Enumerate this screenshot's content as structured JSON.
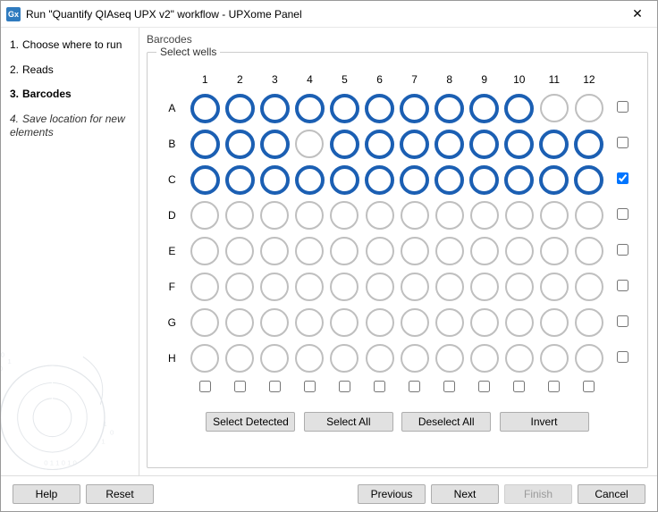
{
  "titlebar": {
    "icon_text": "Gx",
    "title": "Run \"Quantify QIAseq UPX v2\" workflow - UPXome Panel",
    "close_glyph": "✕"
  },
  "sidebar": {
    "steps": [
      {
        "num": "1.",
        "label": "Choose where to run",
        "state": "normal"
      },
      {
        "num": "2.",
        "label": "Reads",
        "state": "normal"
      },
      {
        "num": "3.",
        "label": "Barcodes",
        "state": "active"
      },
      {
        "num": "4.",
        "label": "Save location for new elements",
        "state": "pending"
      }
    ]
  },
  "barcodes": {
    "section_label": "Barcodes",
    "group_legend": "Select wells",
    "columns": [
      "1",
      "2",
      "3",
      "4",
      "5",
      "6",
      "7",
      "8",
      "9",
      "10",
      "11",
      "12"
    ],
    "rows": [
      "A",
      "B",
      "C",
      "D",
      "E",
      "F",
      "G",
      "H"
    ],
    "selected_wells": [
      "A1",
      "A2",
      "A3",
      "A4",
      "A5",
      "A6",
      "A7",
      "A8",
      "A9",
      "A10",
      "B1",
      "B2",
      "B3",
      "B5",
      "B6",
      "B7",
      "B8",
      "B9",
      "B10",
      "B11",
      "B12",
      "C1",
      "C2",
      "C3",
      "C4",
      "C5",
      "C6",
      "C7",
      "C8",
      "C9",
      "C10",
      "C11",
      "C12"
    ],
    "row_checkboxes": {
      "A": false,
      "B": false,
      "C": true,
      "D": false,
      "E": false,
      "F": false,
      "G": false,
      "H": false
    },
    "col_checkboxes": {
      "1": false,
      "2": false,
      "3": false,
      "4": false,
      "5": false,
      "6": false,
      "7": false,
      "8": false,
      "9": false,
      "10": false,
      "11": false,
      "12": false
    },
    "buttons": {
      "select_detected": "Select Detected",
      "select_all": "Select All",
      "deselect_all": "Deselect All",
      "invert": "Invert"
    }
  },
  "footer": {
    "help": "Help",
    "reset": "Reset",
    "previous": "Previous",
    "next": "Next",
    "finish": "Finish",
    "cancel": "Cancel",
    "finish_enabled": false
  }
}
